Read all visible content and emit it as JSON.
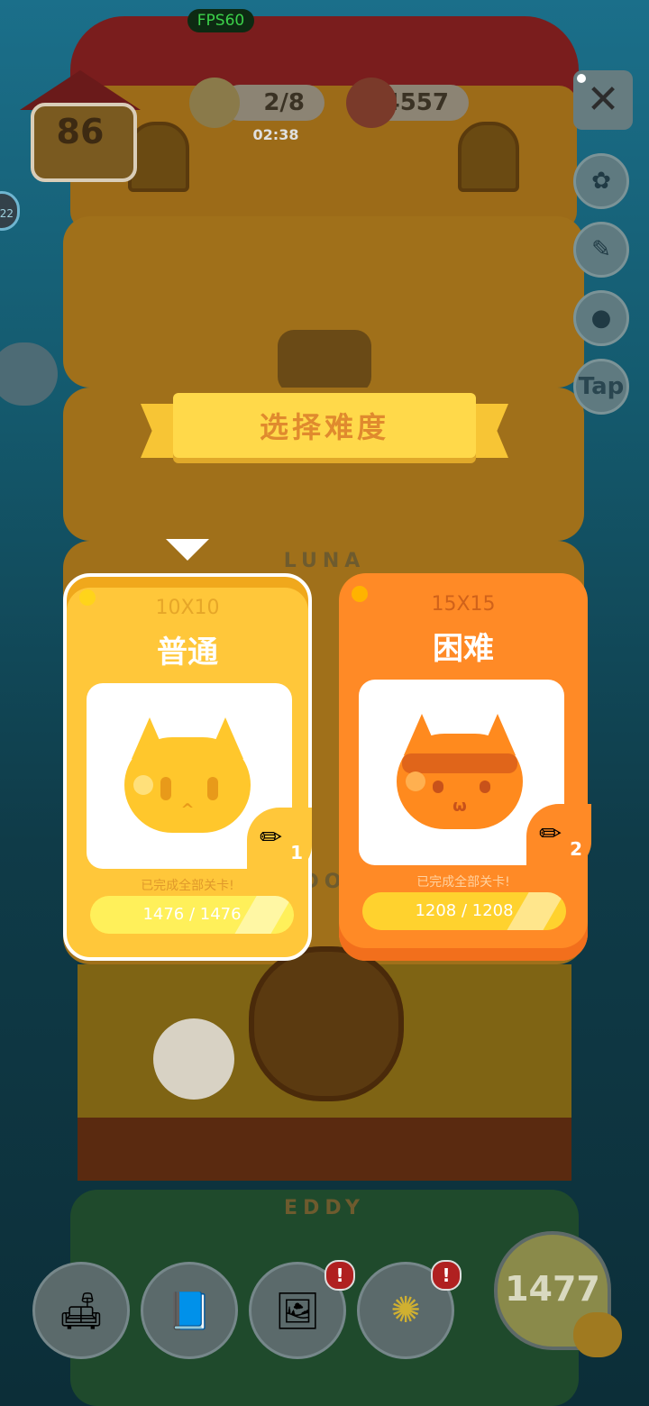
{
  "status": {
    "fps": "FPS60"
  },
  "hud": {
    "home_level": "86",
    "pencils": "2/8",
    "timer": "02:38",
    "coins": "4557",
    "left_bubble": "22"
  },
  "side_buttons": [
    {
      "name": "settings-gear",
      "glyph": "✿"
    },
    {
      "name": "brush-palette",
      "glyph": "✎"
    },
    {
      "name": "stamp",
      "glyph": "●"
    },
    {
      "name": "tap",
      "glyph": "Tap"
    }
  ],
  "floors": {
    "luna": "LUNA",
    "eddy": "EDDY",
    "middle_hidden": "DO"
  },
  "dialog": {
    "title": "选择难度",
    "options": [
      {
        "grid": "10X10",
        "name": "普通",
        "level": "1",
        "status": "已完成全部关卡!",
        "progress_text": "1476 / 1476",
        "progress": 1.0,
        "selected": true
      },
      {
        "grid": "15X15",
        "name": "困难",
        "level": "2",
        "status": "已完成全部关卡!",
        "progress_text": "1208 / 1208",
        "progress": 1.0,
        "selected": false
      }
    ]
  },
  "bottom_nav": {
    "items": [
      {
        "name": "furniture",
        "glyph": "🛋",
        "badge": ""
      },
      {
        "name": "book",
        "glyph": "📘",
        "badge": ""
      },
      {
        "name": "picture",
        "glyph": "🖼",
        "badge": "!"
      },
      {
        "name": "lamp",
        "glyph": "✺",
        "badge": "!"
      }
    ],
    "score": "1477"
  },
  "colors": {
    "normal_card": "#ffc73a",
    "hard_card": "#ff8a26",
    "banner": "#ffd94a",
    "banner_text": "#e08a2e"
  }
}
